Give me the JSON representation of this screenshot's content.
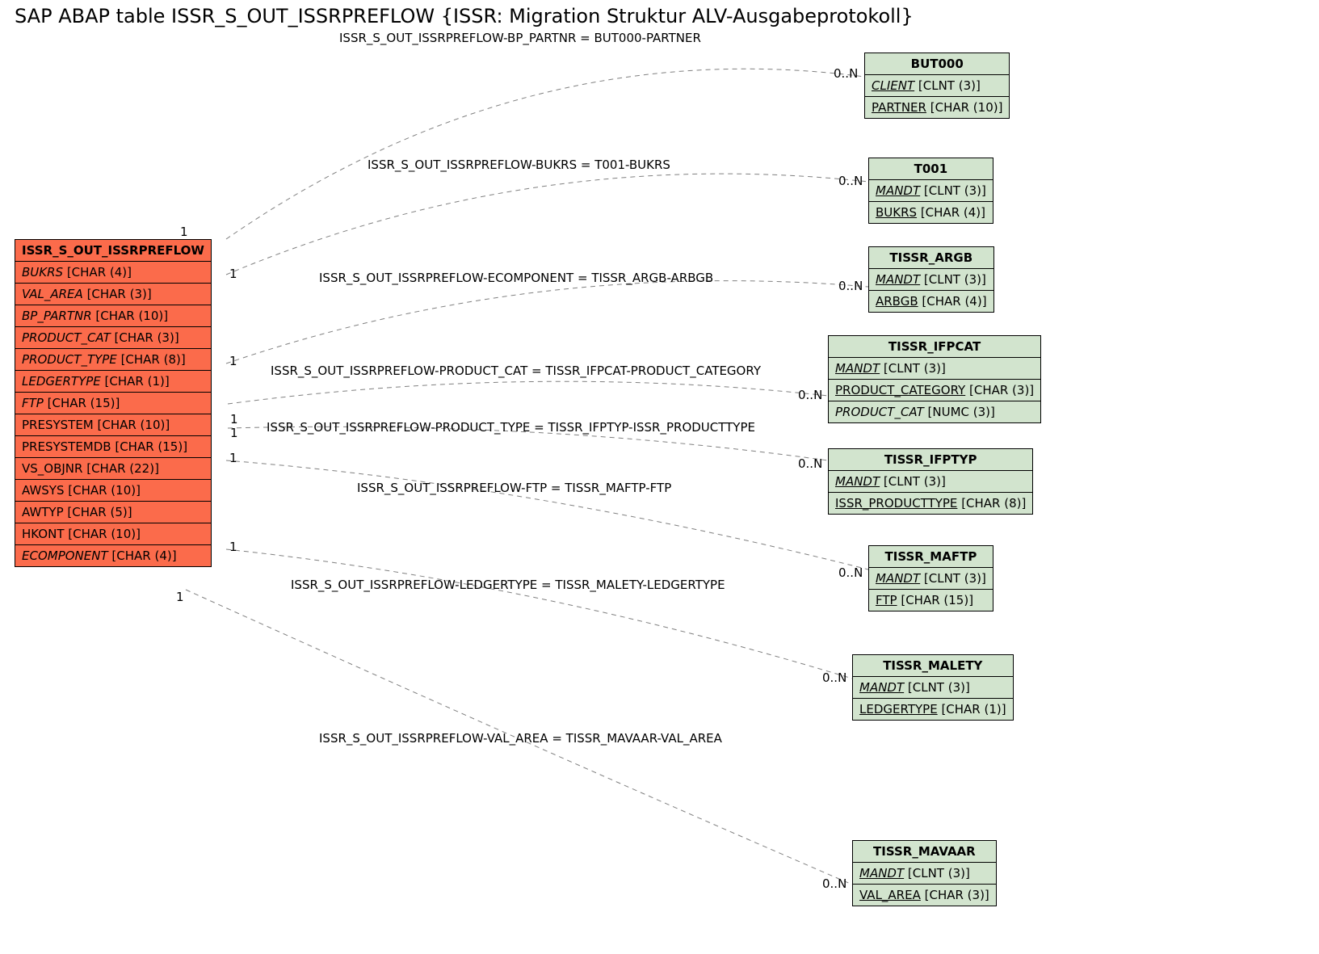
{
  "title": "SAP ABAP table ISSR_S_OUT_ISSRPREFLOW {ISSR: Migration Struktur ALV-Ausgabeprotokoll}",
  "main": {
    "name": "ISSR_S_OUT_ISSRPREFLOW",
    "fields": [
      {
        "name": "BUKRS",
        "type": "[CHAR (4)]",
        "italic": true
      },
      {
        "name": "VAL_AREA",
        "type": "[CHAR (3)]",
        "italic": true
      },
      {
        "name": "BP_PARTNR",
        "type": "[CHAR (10)]",
        "italic": true
      },
      {
        "name": "PRODUCT_CAT",
        "type": "[CHAR (3)]",
        "italic": true
      },
      {
        "name": "PRODUCT_TYPE",
        "type": "[CHAR (8)]",
        "italic": true
      },
      {
        "name": "LEDGERTYPE",
        "type": "[CHAR (1)]",
        "italic": true
      },
      {
        "name": "FTP",
        "type": "[CHAR (15)]",
        "italic": true
      },
      {
        "name": "PRESYSTEM",
        "type": "[CHAR (10)]",
        "italic": false
      },
      {
        "name": "PRESYSTEMDB",
        "type": "[CHAR (15)]",
        "italic": false
      },
      {
        "name": "VS_OBJNR",
        "type": "[CHAR (22)]",
        "italic": false
      },
      {
        "name": "AWSYS",
        "type": "[CHAR (10)]",
        "italic": false
      },
      {
        "name": "AWTYP",
        "type": "[CHAR (5)]",
        "italic": false
      },
      {
        "name": "HKONT",
        "type": "[CHAR (10)]",
        "italic": false
      },
      {
        "name": "ECOMPONENT",
        "type": "[CHAR (4)]",
        "italic": true
      }
    ]
  },
  "targets": [
    {
      "name": "BUT000",
      "fields": [
        {
          "name": "CLIENT",
          "type": "[CLNT (3)]",
          "u": true,
          "i": true
        },
        {
          "name": "PARTNER",
          "type": "[CHAR (10)]",
          "u": true
        }
      ]
    },
    {
      "name": "T001",
      "fields": [
        {
          "name": "MANDT",
          "type": "[CLNT (3)]",
          "u": true,
          "i": true
        },
        {
          "name": "BUKRS",
          "type": "[CHAR (4)]",
          "u": true
        }
      ]
    },
    {
      "name": "TISSR_ARGB",
      "fields": [
        {
          "name": "MANDT",
          "type": "[CLNT (3)]",
          "u": true,
          "i": true
        },
        {
          "name": "ARBGB",
          "type": "[CHAR (4)]",
          "u": true
        }
      ]
    },
    {
      "name": "TISSR_IFPCAT",
      "fields": [
        {
          "name": "MANDT",
          "type": "[CLNT (3)]",
          "u": true,
          "i": true
        },
        {
          "name": "PRODUCT_CATEGORY",
          "type": "[CHAR (3)]",
          "u": true
        },
        {
          "name": "PRODUCT_CAT",
          "type": "[NUMC (3)]",
          "i": true
        }
      ]
    },
    {
      "name": "TISSR_IFPTYP",
      "fields": [
        {
          "name": "MANDT",
          "type": "[CLNT (3)]",
          "u": true,
          "i": true
        },
        {
          "name": "ISSR_PRODUCTTYPE",
          "type": "[CHAR (8)]",
          "u": true
        }
      ]
    },
    {
      "name": "TISSR_MAFTP",
      "fields": [
        {
          "name": "MANDT",
          "type": "[CLNT (3)]",
          "u": true,
          "i": true
        },
        {
          "name": "FTP",
          "type": "[CHAR (15)]",
          "u": true
        }
      ]
    },
    {
      "name": "TISSR_MALETY",
      "fields": [
        {
          "name": "MANDT",
          "type": "[CLNT (3)]",
          "u": true,
          "i": true
        },
        {
          "name": "LEDGERTYPE",
          "type": "[CHAR (1)]",
          "u": true
        }
      ]
    },
    {
      "name": "TISSR_MAVAAR",
      "fields": [
        {
          "name": "MANDT",
          "type": "[CLNT (3)]",
          "u": true,
          "i": true
        },
        {
          "name": "VAL_AREA",
          "type": "[CHAR (3)]",
          "u": true
        }
      ]
    }
  ],
  "relations": [
    {
      "label": "ISSR_S_OUT_ISSRPREFLOW-BP_PARTNR = BUT000-PARTNER"
    },
    {
      "label": "ISSR_S_OUT_ISSRPREFLOW-BUKRS = T001-BUKRS"
    },
    {
      "label": "ISSR_S_OUT_ISSRPREFLOW-ECOMPONENT = TISSR_ARGB-ARBGB"
    },
    {
      "label": "ISSR_S_OUT_ISSRPREFLOW-PRODUCT_CAT = TISSR_IFPCAT-PRODUCT_CATEGORY"
    },
    {
      "label": "ISSR_S_OUT_ISSRPREFLOW-PRODUCT_TYPE = TISSR_IFPTYP-ISSR_PRODUCTTYPE"
    },
    {
      "label": "ISSR_S_OUT_ISSRPREFLOW-FTP = TISSR_MAFTP-FTP"
    },
    {
      "label": "ISSR_S_OUT_ISSRPREFLOW-LEDGERTYPE = TISSR_MALETY-LEDGERTYPE"
    },
    {
      "label": "ISSR_S_OUT_ISSRPREFLOW-VAL_AREA = TISSR_MAVAAR-VAL_AREA"
    }
  ],
  "card_src": "1",
  "card_tgt": "0..N"
}
